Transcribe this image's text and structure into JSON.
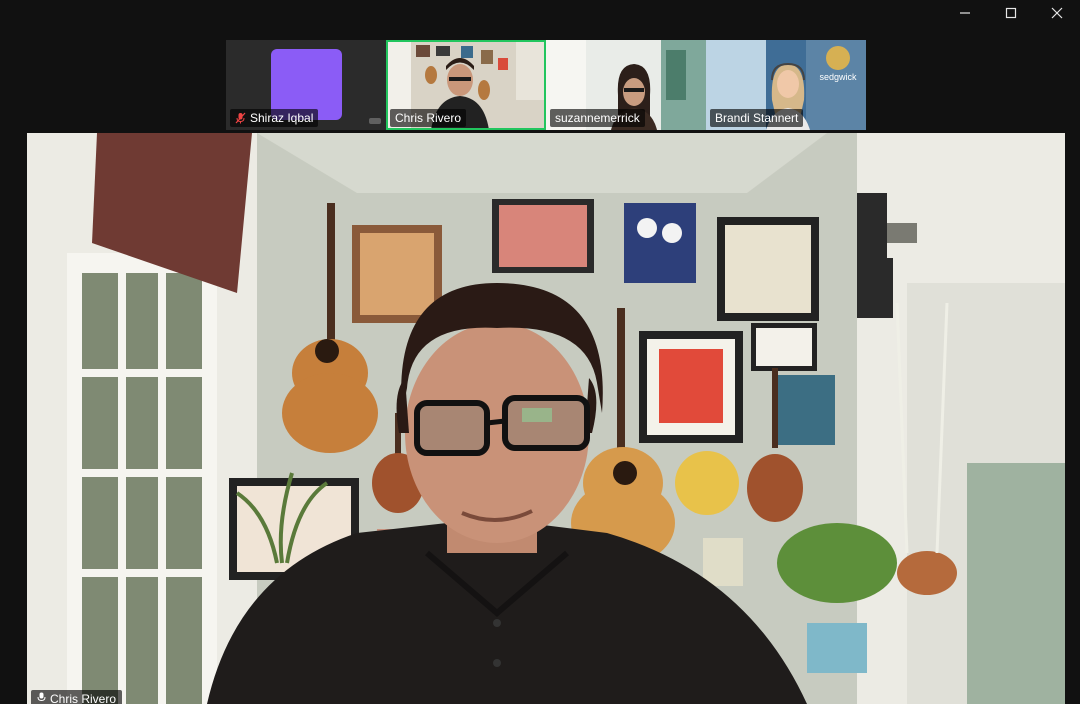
{
  "window": {
    "controls": [
      "minimize",
      "maximize",
      "close"
    ]
  },
  "participants": [
    {
      "name": "Shiraz Iqbal",
      "muted": true,
      "video_on": false,
      "avatar_color": "#8b5cf6"
    },
    {
      "name": "Chris Rivero",
      "muted": false,
      "video_on": true,
      "speaking": true
    },
    {
      "name": "suzannemerrick",
      "muted": false,
      "video_on": true
    },
    {
      "name": "Brandi Stannert",
      "muted": false,
      "video_on": true
    }
  ],
  "main_video": {
    "speaker_name": "Chris Rivero"
  },
  "colors": {
    "background": "#111111",
    "speaking_border": "#22c55e",
    "avatar": "#8b5cf6",
    "mute": "#ef4444"
  },
  "icons": [
    "minimize-icon",
    "maximize-icon",
    "close-icon",
    "mic-muted-icon",
    "mic-icon"
  ]
}
